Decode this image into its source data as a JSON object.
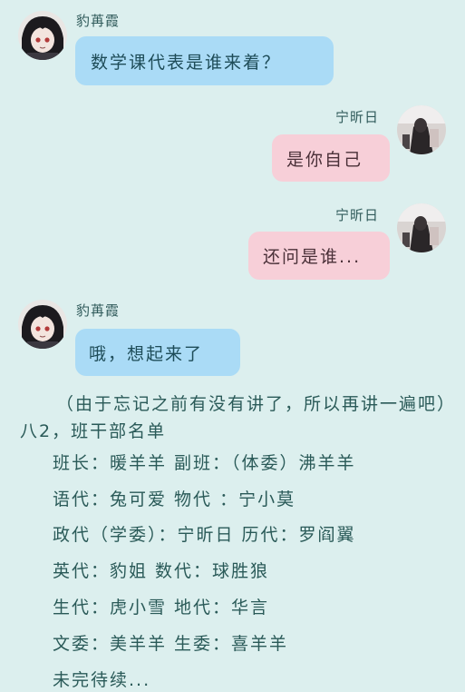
{
  "messages": [
    {
      "sender": "豹苒霞",
      "text": "数学课代表是谁来着？",
      "side": "left"
    },
    {
      "sender": "宁昕日",
      "text": "是你自己",
      "side": "right"
    },
    {
      "sender": "宁昕日",
      "text": "还问是谁...",
      "side": "right"
    },
    {
      "sender": "豹苒霞",
      "text": "哦，想起来了",
      "side": "left"
    }
  ],
  "narration": "（由于忘记之前有没有讲了，所以再讲一遍吧）八2，班干部名单",
  "roster": [
    "班长：暖羊羊 副班：（体委）沸羊羊",
    "语代：兔可爱 物代 ：宁小莫",
    "政代（学委）：宁昕日 历代：罗阎翼",
    "英代：豹姐 数代：球胜狼",
    "生代：虎小雪 地代：华言",
    "文委：美羊羊 生委：喜羊羊",
    "未完待续..."
  ],
  "colors": {
    "background": "#dcefee",
    "left_bubble": "#aadbf6",
    "right_bubble": "#f7cfd8"
  }
}
